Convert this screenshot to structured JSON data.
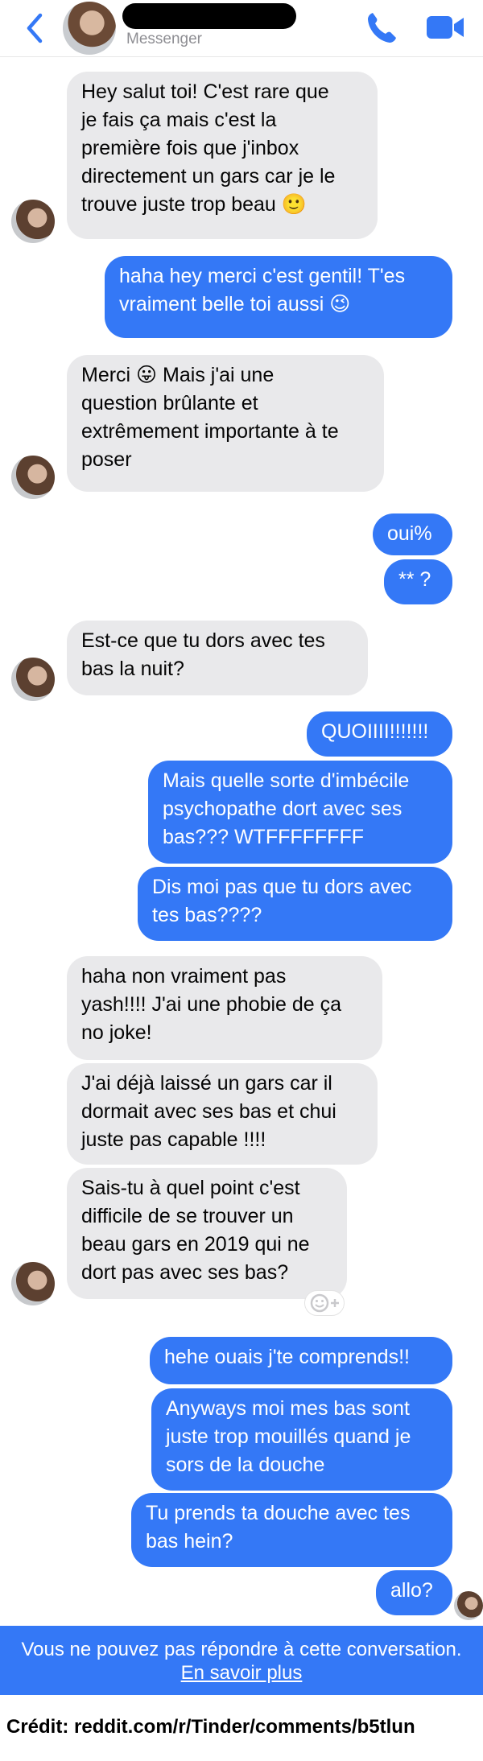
{
  "header": {
    "subtitle": "Messenger",
    "icons": {
      "back": "chevron-left-icon",
      "phone": "phone-icon",
      "video": "video-camera-icon"
    },
    "accent_color": "#3478f6"
  },
  "messages": [
    {
      "sender": "contact",
      "text": "Hey salut toi! C'est rare que\nje fais ça mais c'est la\npremière fois que j'inbox\ndirectement un gars car je le\ntrouve juste trop beau 🙂"
    },
    {
      "sender": "me",
      "text": "haha hey merci c'est gentil! T'es\nvraiment belle toi aussi 😉"
    },
    {
      "sender": "contact",
      "text": "Merci 😛 Mais j'ai une\nquestion brûlante et\nextrêmement importante à te\nposer"
    },
    {
      "sender": "me",
      "text": "oui%"
    },
    {
      "sender": "me",
      "text": "** ?"
    },
    {
      "sender": "contact",
      "text": "Est-ce que tu dors avec tes\nbas la nuit?"
    },
    {
      "sender": "me",
      "text": "QUOIIII!!!!!!!"
    },
    {
      "sender": "me",
      "text": "Mais quelle sorte d'imbécile\npsychopathe dort avec ses\nbas??? WTFFFFFFFF"
    },
    {
      "sender": "me",
      "text": "Dis moi pas que tu dors avec\ntes bas????"
    },
    {
      "sender": "contact",
      "text": "haha non vraiment pas\nyash!!!! J'ai une phobie de ça\nno joke!"
    },
    {
      "sender": "contact",
      "text": "J'ai déjà laissé un gars car il\ndormait avec ses bas et chui\njuste pas capable !!!!"
    },
    {
      "sender": "contact",
      "text": "Sais-tu à quel point c'est\ndifficile de se trouver un\nbeau gars en 2019 qui ne\ndort pas avec ses bas?"
    },
    {
      "sender": "me",
      "text": "hehe ouais j'te comprends!!"
    },
    {
      "sender": "me",
      "text": "Anyways moi mes bas sont\njuste trop mouillés quand je\nsors de la douche"
    },
    {
      "sender": "me",
      "text": "Tu prends ta douche avec tes\nbas hein?"
    },
    {
      "sender": "me",
      "text": "allo?"
    }
  ],
  "reaction_button": {
    "icon": "add-reaction-icon"
  },
  "banner": {
    "text": "Vous ne pouvez pas répondre à cette conversation.",
    "link": "En savoir plus"
  },
  "credit": "Crédit: reddit.com/r/Tinder/comments/b5tlun",
  "colors": {
    "incoming_bubble": "#e9e9eb",
    "outgoing_bubble": "#3478f6",
    "banner": "#3478f6"
  }
}
